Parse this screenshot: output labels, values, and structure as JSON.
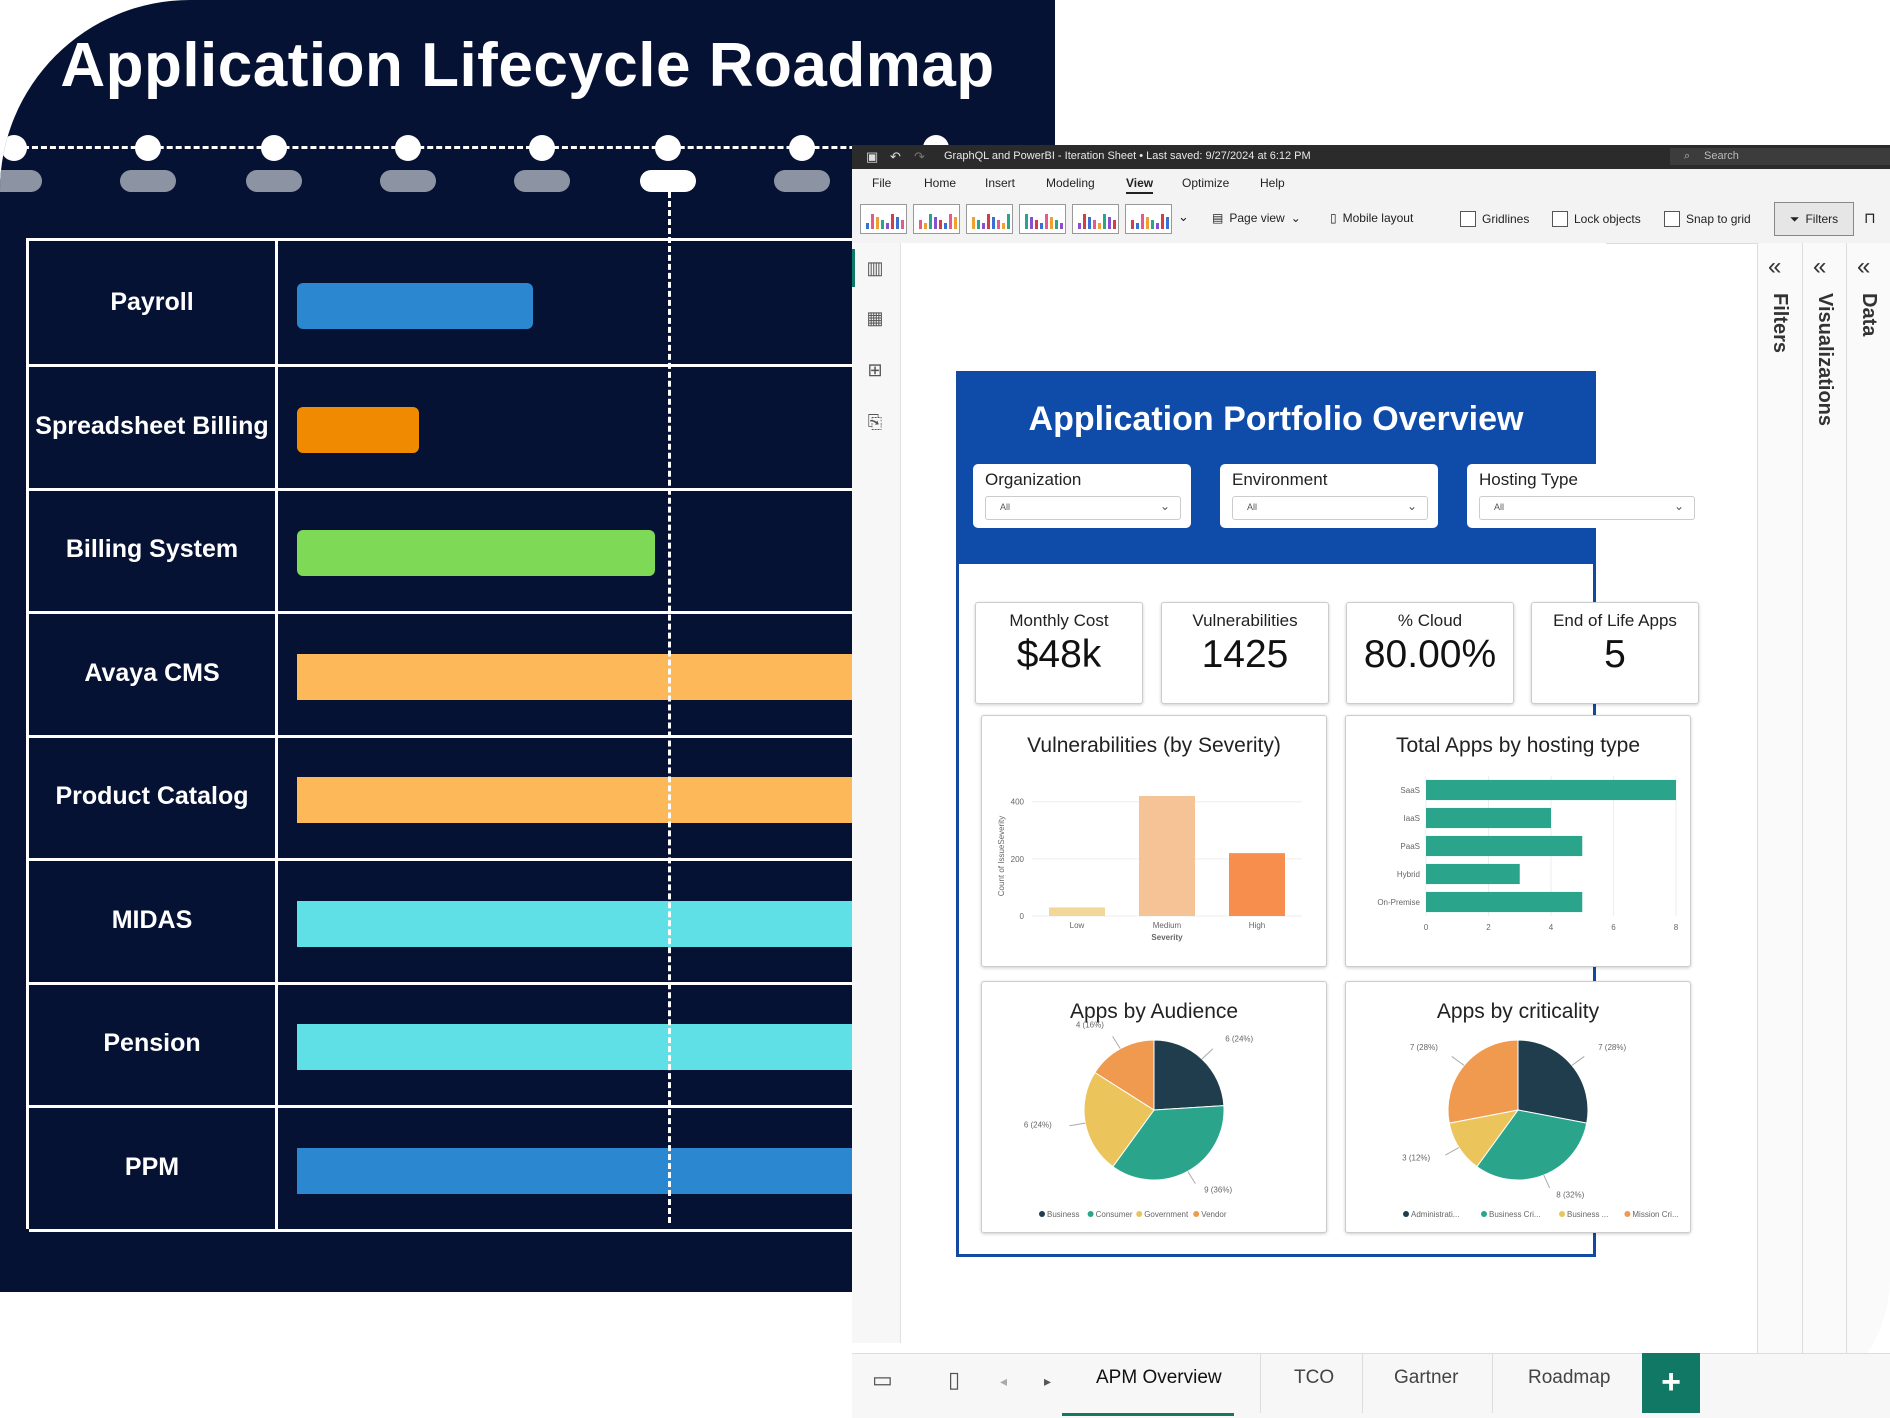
{
  "roadmap": {
    "title": "Application Lifecycle Roadmap",
    "rows": [
      {
        "label": "Payroll",
        "color": "#2a87d0",
        "start": 0.0,
        "length": 0.31
      },
      {
        "label": "Spreadsheet Billing",
        "color": "#f08a00",
        "start": 0.0,
        "length": 0.16
      },
      {
        "label": "Billing System",
        "color": "#7ed957",
        "start": 0.0,
        "length": 0.47
      },
      {
        "label": "Avaya CMS",
        "color": "#fdb85a",
        "start": 0.0,
        "length": 1.0
      },
      {
        "label": "Product Catalog",
        "color": "#fdb85a",
        "start": 0.0,
        "length": 1.0
      },
      {
        "label": "MIDAS",
        "color": "#5ee0e6",
        "start": 0.0,
        "length": 1.0
      },
      {
        "label": "Pension",
        "color": "#5ee0e6",
        "start": 0.0,
        "length": 1.0
      },
      {
        "label": "PPM",
        "color": "#2a87d0",
        "start": 0.0,
        "length": 1.0
      }
    ]
  },
  "window": {
    "title": "GraphQL and PowerBI - Iteration Sheet • Last saved: 9/27/2024 at 6:12 PM",
    "search_placeholder": "Search",
    "menu": [
      "File",
      "Home",
      "Insert",
      "Modeling",
      "View",
      "Optimize",
      "Help"
    ],
    "active_menu": "View",
    "ribbon": {
      "page_view": "Page view",
      "mobile_layout": "Mobile layout",
      "gridlines": "Gridlines",
      "lock_objects": "Lock objects",
      "snap_to_grid": "Snap to grid",
      "filters": "Filters"
    },
    "panes": {
      "filters": "Filters",
      "visualizations": "Visualizations",
      "data": "Data"
    },
    "page_tabs": [
      "APM Overview",
      "TCO",
      "Gartner",
      "Roadmap"
    ],
    "active_tab": "APM Overview",
    "add_page": "+"
  },
  "dashboard": {
    "title": "Application Portfolio Overview",
    "slicers": [
      {
        "label": "Organization",
        "value": "All"
      },
      {
        "label": "Environment",
        "value": "All"
      },
      {
        "label": "Hosting Type",
        "value": "All"
      }
    ],
    "kpis": [
      {
        "label": "Monthly Cost",
        "value": "$48k"
      },
      {
        "label": "Vulnerabilities",
        "value": "1425"
      },
      {
        "label": "% Cloud",
        "value": "80.00%"
      },
      {
        "label": "End of Life Apps",
        "value": "5"
      }
    ],
    "vuln_title": "Vulnerabilities (by Severity)",
    "hosting_title": "Total Apps by hosting type",
    "audience_title": "Apps by Audience",
    "criticality_title": "Apps by criticality"
  },
  "chart_data": [
    {
      "type": "bar",
      "title": "Vulnerabilities (by Severity)",
      "categories": [
        "Low",
        "Medium",
        "High"
      ],
      "values": [
        30,
        420,
        220
      ],
      "colors": [
        "#f3d79a",
        "#f5c396",
        "#f78e4e"
      ],
      "xlabel": "Severity",
      "ylabel": "Count of IssueSeverity",
      "yticks": [
        "0",
        "200",
        "400"
      ],
      "ylim": [
        0,
        420
      ]
    },
    {
      "type": "bar",
      "orientation": "horizontal",
      "title": "Total Apps by hosting type",
      "categories": [
        "SaaS",
        "IaaS",
        "PaaS",
        "Hybrid",
        "On-Premise"
      ],
      "values": [
        8,
        4,
        5,
        3,
        5
      ],
      "color": "#2aa58c",
      "xticks": [
        "0",
        "2",
        "4",
        "6",
        "8"
      ],
      "xlim": [
        0,
        8
      ]
    },
    {
      "type": "pie",
      "title": "Apps by Audience",
      "slices": [
        {
          "label": "Business",
          "value": 6,
          "text": "6 (24%)",
          "color": "#1f3d4d"
        },
        {
          "label": "Consumer",
          "value": 9,
          "text": "9 (36%)",
          "color": "#2aa58c"
        },
        {
          "label": "Government",
          "value": 6,
          "text": "6 (24%)",
          "color": "#ebc55b"
        },
        {
          "label": "Vendor",
          "value": 4,
          "text": "4 (16%)",
          "color": "#f09a50"
        }
      ]
    },
    {
      "type": "pie",
      "title": "Apps by criticality",
      "slices": [
        {
          "label": "Administrati...",
          "value": 7,
          "text": "7 (28%)",
          "color": "#1f3d4d"
        },
        {
          "label": "Business Cri...",
          "value": 8,
          "text": "8 (32%)",
          "color": "#2aa58c"
        },
        {
          "label": "Business ...",
          "value": 3,
          "text": "3 (12%)",
          "color": "#ebc55b"
        },
        {
          "label": "Mission Cri...",
          "value": 7,
          "text": "7 (28%)",
          "color": "#f09a50"
        }
      ]
    }
  ]
}
